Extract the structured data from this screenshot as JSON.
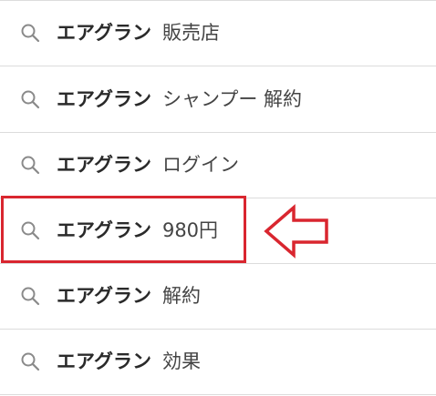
{
  "suggestions": [
    {
      "base": "エアグラン",
      "extra": "販売店"
    },
    {
      "base": "エアグラン",
      "extra": "シャンプー 解約"
    },
    {
      "base": "エアグラン",
      "extra": "ログイン"
    },
    {
      "base": "エアグラン",
      "extra": "980円"
    },
    {
      "base": "エアグラン",
      "extra": "解約"
    },
    {
      "base": "エアグラン",
      "extra": "効果"
    }
  ],
  "colors": {
    "highlight": "#d9262f",
    "divider": "#dcdcdc",
    "icon": "#8a8a8a"
  },
  "icons": {
    "search": "search-icon",
    "annotation_arrow": "left-arrow-icon"
  }
}
